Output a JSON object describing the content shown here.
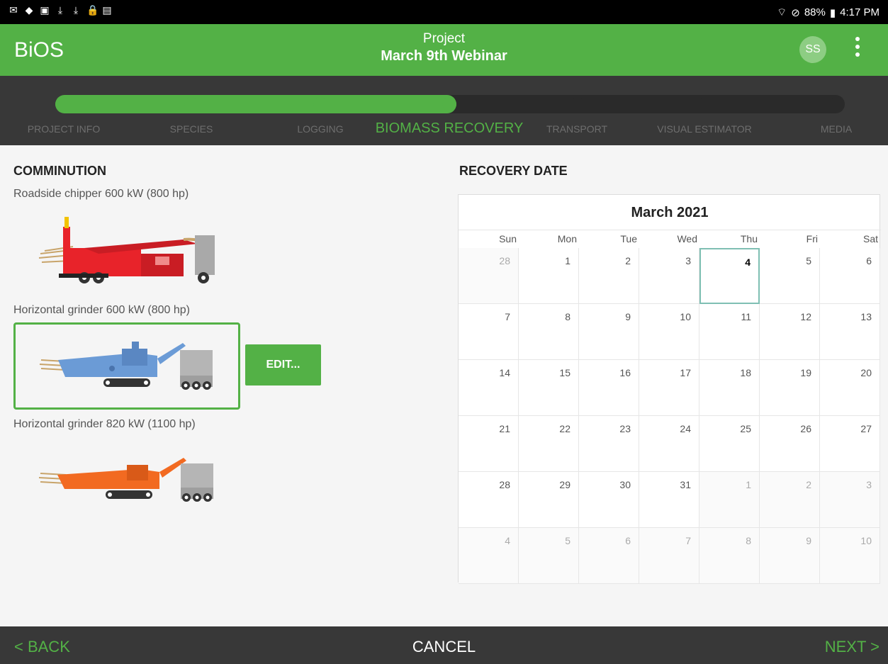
{
  "status_bar": {
    "left_icons": [
      "gmail-icon",
      "bag-icon",
      "image-icon",
      "download-icon",
      "download-icon",
      "lock-icon",
      "no-sim-icon"
    ],
    "battery": "88%",
    "time": "4:17 PM"
  },
  "app_bar": {
    "brand": "BiOS",
    "project_label": "Project",
    "project_name": "March 9th Webinar",
    "avatar_initials": "SS"
  },
  "stepper": {
    "steps": [
      {
        "label": "PROJECT INFO",
        "done": true
      },
      {
        "label": "SPECIES",
        "done": true
      },
      {
        "label": "LOGGING",
        "done": true
      },
      {
        "label": "BIOMASS RECOVERY",
        "done": true,
        "active": true
      },
      {
        "label": "TRANSPORT",
        "done": false
      },
      {
        "label": "VISUAL ESTIMATOR",
        "done": false
      },
      {
        "label": "MEDIA",
        "done": false
      }
    ]
  },
  "comminution": {
    "title": "COMMINUTION",
    "machines": [
      {
        "label": "Roadside chipper 600 kW (800 hp)",
        "color": "#e8232a",
        "selected": false
      },
      {
        "label": "Horizontal grinder 600 kW (800 hp)",
        "color": "#6b9bd6",
        "selected": true
      },
      {
        "label": "Horizontal grinder 820 kW (1100 hp)",
        "color": "#f26a21",
        "selected": false
      }
    ],
    "edit_label": "EDIT..."
  },
  "recovery": {
    "title": "RECOVERY DATE",
    "month": "March 2021",
    "weekdays": [
      "Sun",
      "Mon",
      "Tue",
      "Wed",
      "Thu",
      "Fri",
      "Sat"
    ],
    "weeks": [
      [
        {
          "d": "28",
          "o": true
        },
        {
          "d": "1"
        },
        {
          "d": "2"
        },
        {
          "d": "3"
        },
        {
          "d": "4",
          "today": true
        },
        {
          "d": "5"
        },
        {
          "d": "6"
        }
      ],
      [
        {
          "d": "7"
        },
        {
          "d": "8"
        },
        {
          "d": "9"
        },
        {
          "d": "10"
        },
        {
          "d": "11"
        },
        {
          "d": "12"
        },
        {
          "d": "13"
        }
      ],
      [
        {
          "d": "14"
        },
        {
          "d": "15"
        },
        {
          "d": "16"
        },
        {
          "d": "17"
        },
        {
          "d": "18"
        },
        {
          "d": "19"
        },
        {
          "d": "20"
        }
      ],
      [
        {
          "d": "21"
        },
        {
          "d": "22"
        },
        {
          "d": "23"
        },
        {
          "d": "24"
        },
        {
          "d": "25"
        },
        {
          "d": "26"
        },
        {
          "d": "27"
        }
      ],
      [
        {
          "d": "28"
        },
        {
          "d": "29"
        },
        {
          "d": "30"
        },
        {
          "d": "31"
        },
        {
          "d": "1",
          "o": true
        },
        {
          "d": "2",
          "o": true
        },
        {
          "d": "3",
          "o": true
        }
      ],
      [
        {
          "d": "4",
          "o": true
        },
        {
          "d": "5",
          "o": true
        },
        {
          "d": "6",
          "o": true
        },
        {
          "d": "7",
          "o": true
        },
        {
          "d": "8",
          "o": true
        },
        {
          "d": "9",
          "o": true
        },
        {
          "d": "10",
          "o": true
        }
      ]
    ]
  },
  "bottom_bar": {
    "back": "< BACK",
    "cancel": "CANCEL",
    "next": "NEXT >"
  }
}
